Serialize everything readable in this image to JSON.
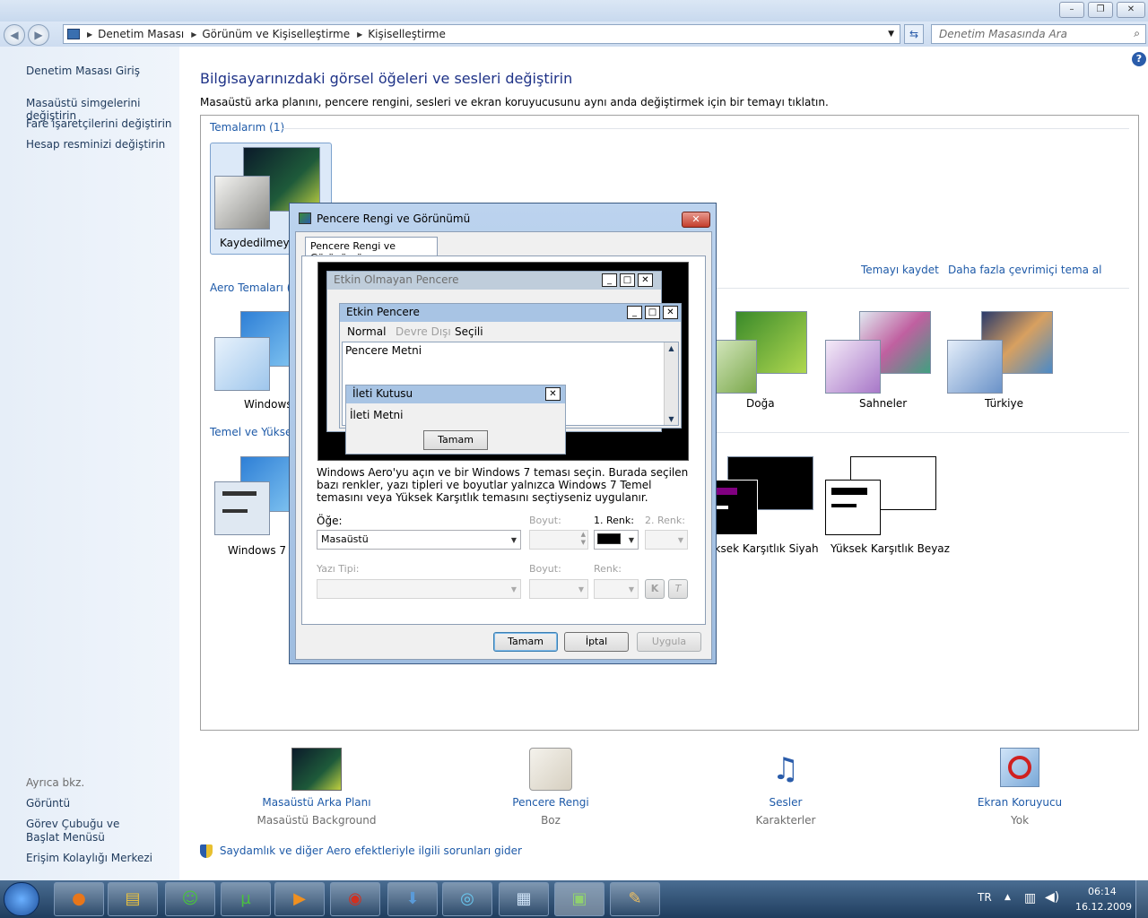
{
  "window": {
    "minimize": "–",
    "maximize": "❐",
    "close": "✕"
  },
  "address": {
    "crumbs": [
      "Denetim Masası",
      "Görünüm ve Kişiselleştirme",
      "Kişiselleştirme"
    ],
    "search_placeholder": "Denetim Masasında Ara"
  },
  "sidebar": {
    "home": "Denetim Masası Giriş",
    "links": [
      "Masaüstü simgelerini değiştirin",
      "Fare işaretçilerini değiştirin",
      "Hesap resminizi değiştirin"
    ],
    "see_also_label": "Ayrıca bkz.",
    "see_also": [
      "Görüntü",
      "Görev Çubuğu ve Başlat Menüsü",
      "Erişim Kolaylığı Merkezi"
    ]
  },
  "main": {
    "title": "Bilgisayarınızdaki görsel öğeleri ve sesleri değiştirin",
    "subtitle": "Masaüstü arka planını, pencere rengini, sesleri ve ekran koruyucusunu aynı anda değiştirmek için bir temayı tıklatın.",
    "my_themes": "Temalarım (1)",
    "unsaved_theme": "Kaydedilmeyen",
    "save_theme": "Temayı kaydet",
    "more_themes": "Daha fazla çevrimiçi tema al",
    "aero_themes": "Aero Temaları (7",
    "aero": [
      "Windows",
      "Doğa",
      "Sahneler",
      "Türkiye"
    ],
    "basic_themes": "Temel ve Yüksek",
    "basic": [
      "Windows 7 T",
      "Yüksek Karşıtlık Siyah",
      "Yüksek Karşıtlık Beyaz"
    ],
    "bottom": [
      {
        "label": "Masaüstü Arka Planı",
        "value": "Masaüstü Background"
      },
      {
        "label": "Pencere Rengi",
        "value": "Boz"
      },
      {
        "label": "Sesler",
        "value": "Karakterler"
      },
      {
        "label": "Ekran Koruyucu",
        "value": "Yok"
      }
    ],
    "troubleshoot": "Saydamlık ve diğer Aero efektleriyle ilgili sorunları gider"
  },
  "dialog": {
    "title": "Pencere Rengi ve Görünümü",
    "tab": "Pencere Rengi ve Görünümü",
    "inactive_window": "Etkin Olmayan Pencere",
    "active_window": "Etkin Pencere",
    "menu_normal": "Normal",
    "menu_disabled": "Devre Dışı",
    "menu_selected": "Seçili",
    "window_text": "Pencere Metni",
    "msgbox_title": "İleti Kutusu",
    "msgbox_text": "İleti Metni",
    "msgbox_ok": "Tamam",
    "info": "Windows Aero'yu açın ve bir Windows 7 teması seçin. Burada seçilen bazı renkler, yazı tipleri ve boyutlar yalnızca Windows 7 Temel temasını veya Yüksek Karşıtlık temasını seçtiyseniz uygulanır.",
    "item_label": "Öğe:",
    "item_value": "Masaüstü",
    "size_label": "Boyut:",
    "color1_label": "1. Renk:",
    "color2_label": "2. Renk:",
    "font_label": "Yazı Tipi:",
    "font_size_label": "Boyut:",
    "font_color_label": "Renk:",
    "bold": "K",
    "italic": "T",
    "ok": "Tamam",
    "cancel": "İptal",
    "apply": "Uygula",
    "color1": "#000000"
  },
  "taskbar": {
    "lang": "TR",
    "time": "06:14",
    "date": "16.12.2009"
  }
}
